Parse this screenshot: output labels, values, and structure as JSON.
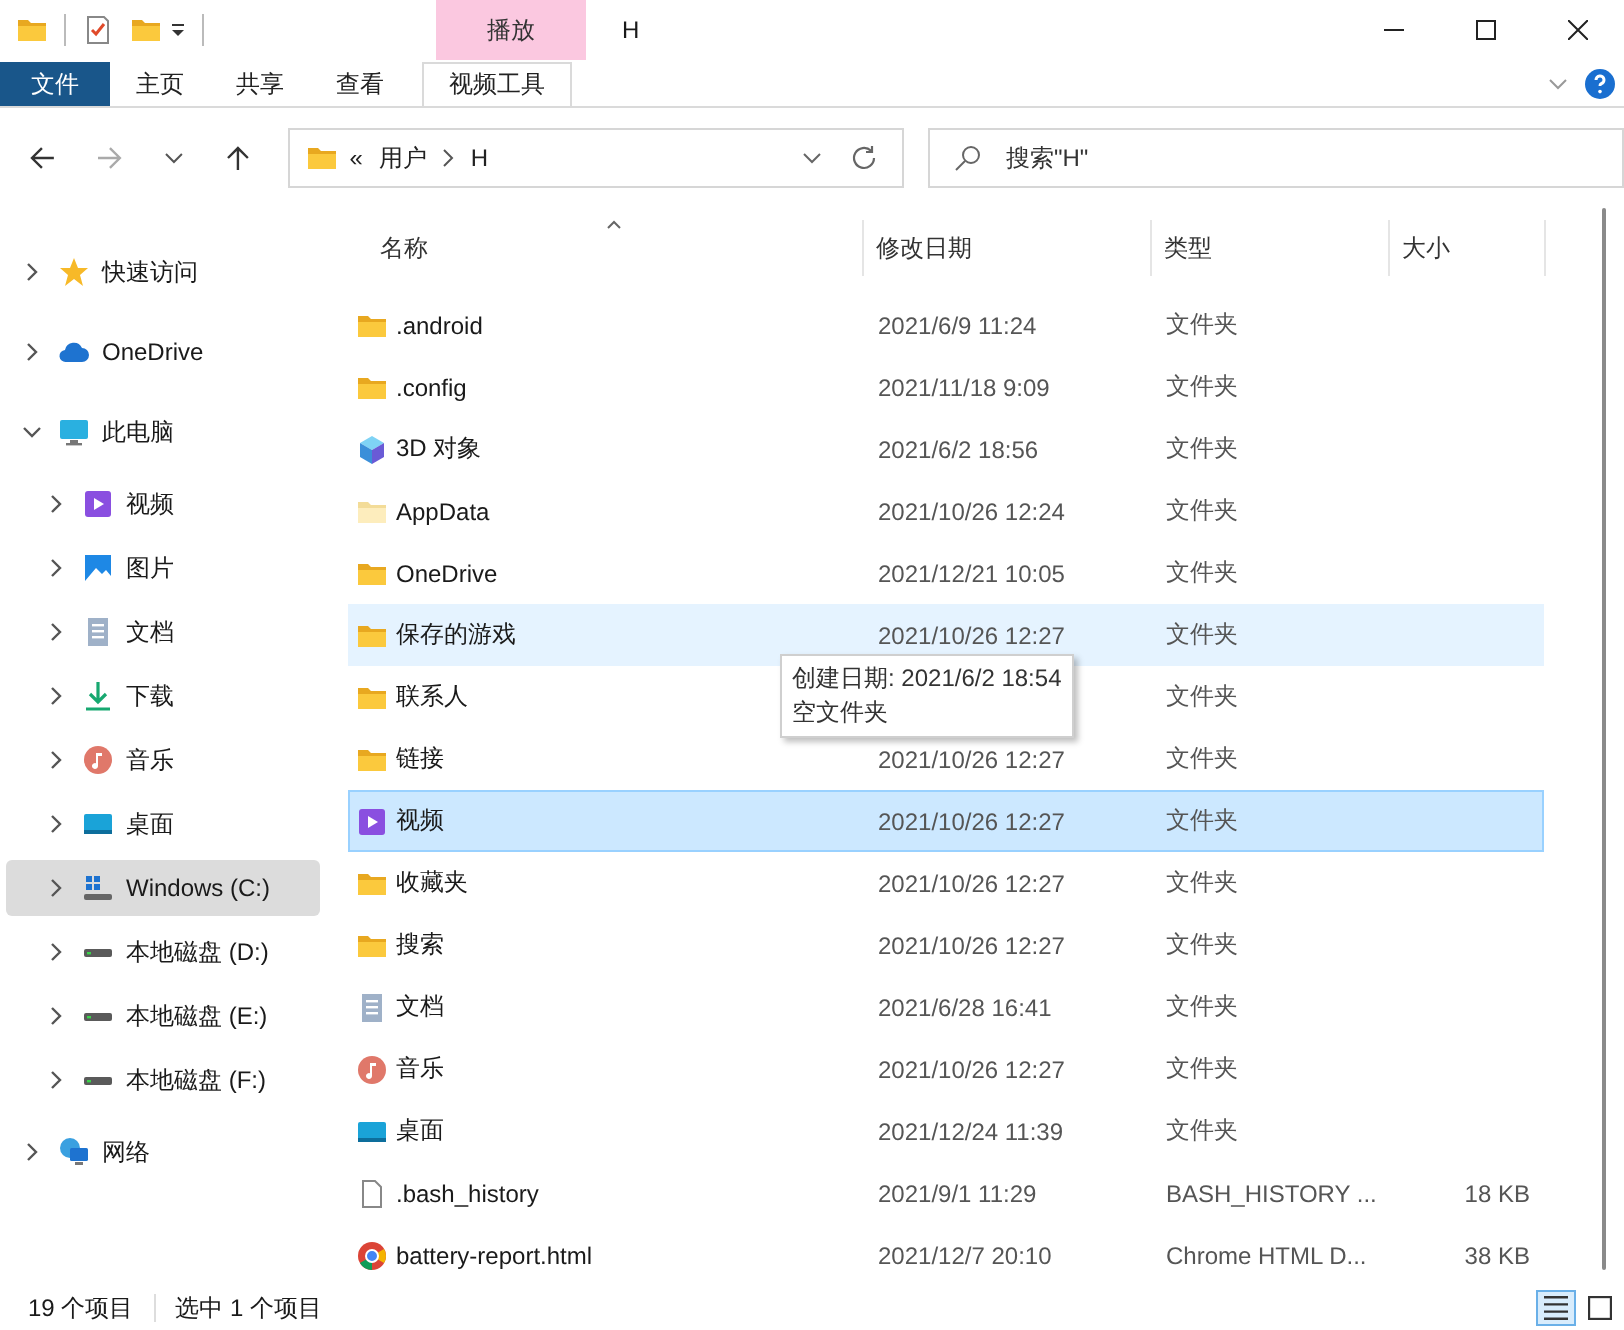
{
  "window": {
    "title": "H"
  },
  "ribbon": {
    "context_label": "播放",
    "tabs": [
      {
        "label": "文件",
        "kind": "file"
      },
      {
        "label": "主页",
        "kind": "normal"
      },
      {
        "label": "共享",
        "kind": "normal"
      },
      {
        "label": "查看",
        "kind": "normal"
      },
      {
        "label": "视频工具",
        "kind": "context"
      }
    ]
  },
  "navigation": {
    "forward_disabled": true
  },
  "address_bar": {
    "overflow": "«",
    "crumbs": [
      "用户",
      "H"
    ]
  },
  "search": {
    "placeholder": "搜索\"H\""
  },
  "sidebar": {
    "items": [
      {
        "label": "快速访问",
        "kind": "star",
        "expanded": false,
        "selected": false
      },
      {
        "label": "OneDrive",
        "kind": "cloud",
        "expanded": false,
        "selected": false
      },
      {
        "label": "此电脑",
        "kind": "monitor",
        "expanded": true,
        "selected": false,
        "children": [
          {
            "label": "视频",
            "kind": "video",
            "expanded": false,
            "selected": false
          },
          {
            "label": "图片",
            "kind": "picture",
            "expanded": false,
            "selected": false
          },
          {
            "label": "文档",
            "kind": "doc",
            "expanded": false,
            "selected": false
          },
          {
            "label": "下载",
            "kind": "download",
            "expanded": false,
            "selected": false
          },
          {
            "label": "音乐",
            "kind": "music",
            "expanded": false,
            "selected": false
          },
          {
            "label": "桌面",
            "kind": "desktop",
            "expanded": false,
            "selected": false
          },
          {
            "label": "Windows (C:)",
            "kind": "windrive",
            "expanded": false,
            "selected": true
          },
          {
            "label": "本地磁盘 (D:)",
            "kind": "drive",
            "expanded": false,
            "selected": false
          },
          {
            "label": "本地磁盘 (E:)",
            "kind": "drive",
            "expanded": false,
            "selected": false
          },
          {
            "label": "本地磁盘 (F:)",
            "kind": "drive",
            "expanded": false,
            "selected": false
          }
        ]
      },
      {
        "label": "网络",
        "kind": "network",
        "expanded": false,
        "selected": false
      }
    ]
  },
  "table": {
    "columns": [
      "名称",
      "修改日期",
      "类型",
      "大小"
    ],
    "rows": [
      {
        "kind": "folder",
        "name": ".android",
        "date": "2021/6/9 11:24",
        "type": "文件夹",
        "selected": false,
        "hovered": false
      },
      {
        "kind": "folder",
        "name": ".config",
        "date": "2021/11/18 9:09",
        "type": "文件夹",
        "selected": false,
        "hovered": false
      },
      {
        "kind": "cube",
        "name": "3D 对象",
        "date": "2021/6/2 18:56",
        "type": "文件夹",
        "selected": false,
        "hovered": false
      },
      {
        "kind": "folder-light",
        "name": "AppData",
        "date": "2021/10/26 12:24",
        "type": "文件夹",
        "selected": false,
        "hovered": false
      },
      {
        "kind": "folder",
        "name": "OneDrive",
        "date": "2021/12/21 10:05",
        "type": "文件夹",
        "selected": false,
        "hovered": false
      },
      {
        "kind": "folder",
        "name": "保存的游戏",
        "date": "2021/10/26 12:27",
        "type": "文件夹",
        "selected": false,
        "hovered": true
      },
      {
        "kind": "folder",
        "name": "联系人",
        "type": "文件夹",
        "selected": false,
        "hovered": false
      },
      {
        "kind": "folder",
        "name": "链接",
        "date": "2021/10/26 12:27",
        "type": "文件夹",
        "selected": false,
        "hovered": false
      },
      {
        "kind": "video",
        "name": "视频",
        "date": "2021/10/26 12:27",
        "type": "文件夹",
        "selected": true,
        "hovered": false
      },
      {
        "kind": "folder",
        "name": "收藏夹",
        "date": "2021/10/26 12:27",
        "type": "文件夹",
        "selected": false,
        "hovered": false
      },
      {
        "kind": "folder",
        "name": "搜索",
        "date": "2021/10/26 12:27",
        "type": "文件夹",
        "selected": false,
        "hovered": false
      },
      {
        "kind": "doc",
        "name": "文档",
        "date": "2021/6/28 16:41",
        "type": "文件夹",
        "selected": false,
        "hovered": false
      },
      {
        "kind": "music",
        "name": "音乐",
        "date": "2021/10/26 12:27",
        "type": "文件夹",
        "selected": false,
        "hovered": false
      },
      {
        "kind": "desktop",
        "name": "桌面",
        "date": "2021/12/24 11:39",
        "type": "文件夹",
        "selected": false,
        "hovered": false
      },
      {
        "kind": "file",
        "name": ".bash_history",
        "date": "2021/9/1 11:29",
        "type": "BASH_HISTORY ...",
        "size": "18 KB",
        "selected": false,
        "hovered": false
      },
      {
        "kind": "chrome",
        "name": "battery-report.html",
        "date": "2021/12/7 20:10",
        "type": "Chrome HTML D...",
        "size": "38 KB",
        "selected": false,
        "hovered": false
      }
    ]
  },
  "tooltip": {
    "lines": [
      "创建日期: 2021/6/2 18:54",
      "空文件夹"
    ]
  },
  "status_bar": {
    "count": "19 个项目",
    "selection": "选中 1 个项目",
    "views": [
      {
        "kind": "details",
        "selected": true
      },
      {
        "kind": "large-icons",
        "selected": false
      }
    ]
  }
}
